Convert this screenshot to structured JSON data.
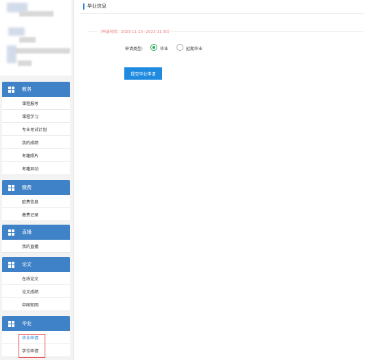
{
  "sidebar": {
    "sections": [
      {
        "title": "教务",
        "items": [
          "课程报考",
          "课程学习",
          "专业考试计划",
          "我的成绩",
          "考籍照片",
          "考籍异动"
        ]
      },
      {
        "title": "缴费",
        "items": [
          "欧费信息",
          "缴费记录"
        ]
      },
      {
        "title": "直播",
        "items": [
          "我的直播"
        ]
      },
      {
        "title": "论文",
        "items": [
          "在线论文",
          "论文成绩",
          "中国知网"
        ]
      },
      {
        "title": "毕业",
        "items": [
          "毕业申请",
          "学位申请"
        ]
      }
    ]
  },
  "main": {
    "title": "毕业信息",
    "period": "（申请时间：2023-11-13~2023-11-30）",
    "apply_type_label": "申请类型:",
    "options": [
      "毕业",
      "延期毕业"
    ],
    "selected_option": "毕业",
    "submit_label": "提交毕业申请"
  },
  "colors": {
    "accent": "#3f82c7",
    "button": "#1e8be0",
    "radio": "#27a95a",
    "period": "#e97b7b"
  }
}
